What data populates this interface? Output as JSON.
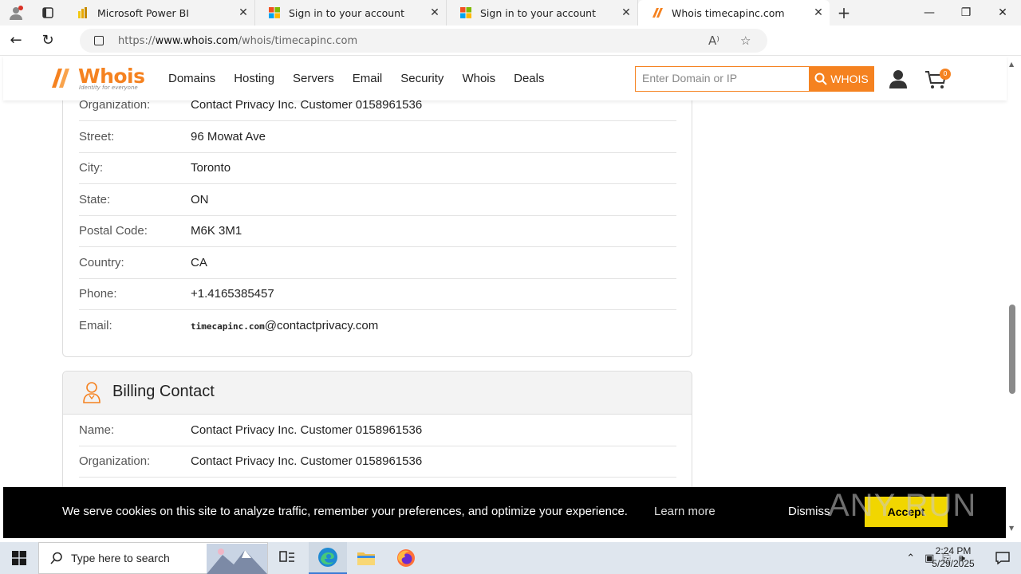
{
  "browser": {
    "tabs": [
      {
        "title": "Microsoft Power BI",
        "icon": "power-bi-icon"
      },
      {
        "title": "Sign in to your account",
        "icon": "microsoft-icon"
      },
      {
        "title": "Sign in to your account",
        "icon": "microsoft-icon"
      },
      {
        "title": "Whois timecapinc.com",
        "icon": "whois-icon",
        "active": true
      }
    ],
    "url_prefix": "https://",
    "url_host": "www.whois.com",
    "url_path": "/whois/timecapinc.com"
  },
  "site": {
    "logo_text": "Whois",
    "logo_tagline": "Identity for everyone",
    "nav": [
      "Domains",
      "Hosting",
      "Servers",
      "Email",
      "Security",
      "Whois",
      "Deals"
    ],
    "search_placeholder": "Enter Domain or IP",
    "search_button": "WHOIS",
    "cart_count": "0",
    "brand_color": "#f58220"
  },
  "registrant_rows": [
    {
      "label": "Organization:",
      "value": "Contact Privacy Inc. Customer 0158961536"
    },
    {
      "label": "Street:",
      "value": "96 Mowat Ave"
    },
    {
      "label": "City:",
      "value": "Toronto"
    },
    {
      "label": "State:",
      "value": "ON"
    },
    {
      "label": "Postal Code:",
      "value": "M6K 3M1"
    },
    {
      "label": "Country:",
      "value": "CA"
    },
    {
      "label": "Phone:",
      "value": "+1.4165385457"
    },
    {
      "label": "Email:",
      "value_image": "timecapinc.com",
      "value": "@contactprivacy.com"
    }
  ],
  "billing": {
    "title": "Billing Contact",
    "rows": [
      {
        "label": "Name:",
        "value": "Contact Privacy Inc. Customer 0158961536"
      },
      {
        "label": "Organization:",
        "value": "Contact Privacy Inc. Customer 0158961536"
      }
    ]
  },
  "cookie": {
    "message": "We serve cookies on this site to analyze traffic, remember your preferences, and optimize your experience.",
    "learn_more": "Learn more",
    "dismiss": "Dismiss",
    "accept": "Accept"
  },
  "watermark": "ANY RUN",
  "taskbar": {
    "search_placeholder": "Type here to search",
    "time": "2:24 PM",
    "date": "5/29/2025"
  }
}
